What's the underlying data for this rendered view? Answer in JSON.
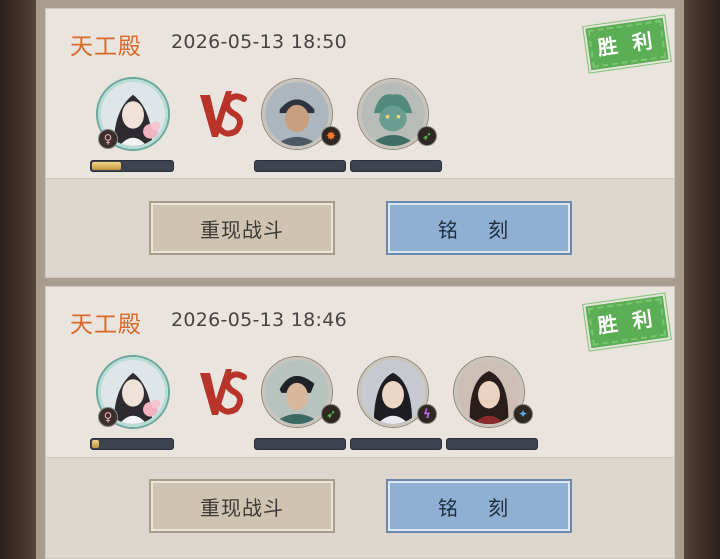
{
  "records": [
    {
      "location": "天工殿",
      "time": "2026-05-13 18:50",
      "result": "胜 利",
      "self_badge": "♀",
      "self_progress": 0.35,
      "opponent_badges": [
        "fire",
        "wind"
      ],
      "replay_label": "重现战斗",
      "engrave_label": "铭 刻"
    },
    {
      "location": "天工殿",
      "time": "2026-05-13 18:46",
      "result": "胜 利",
      "self_badge": "♀",
      "self_progress": 0.08,
      "opponent_badges": [
        "wind",
        "thunder",
        "water"
      ],
      "replay_label": "重现战斗",
      "engrave_label": "铭 刻"
    }
  ],
  "colors": {
    "location": "#d86a2b",
    "victory": "#5cae55",
    "engrave": "#8fb0d3",
    "replay": "#cfc4b2"
  }
}
